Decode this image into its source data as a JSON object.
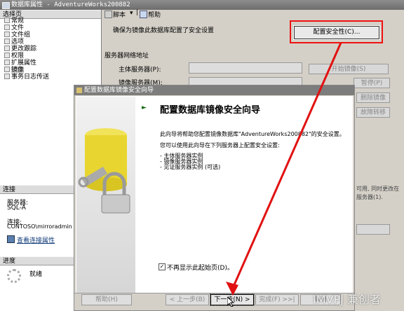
{
  "window": {
    "title": "数据库属性 - AdventureWorks200882"
  },
  "left_pane": {
    "select_page_header": "选择页",
    "pages": [
      "常规",
      "文件",
      "文件组",
      "选项",
      "更改跟踪",
      "权限",
      "扩展属性",
      "镜像",
      "事务日志传送"
    ],
    "connection_header": "连接",
    "server_label": "服务器:",
    "server_value": "SQL-A",
    "connection_label": "连接:",
    "connection_value": "CONTOSO\\mirroradmin",
    "view_connection_link": "查看连接属性",
    "progress_header": "进度",
    "progress_status": "就绪"
  },
  "toolbar": {
    "script_label": "脚本",
    "help_label": "帮助"
  },
  "mirroring": {
    "instruction": "确保为镜像此数据库配置了安全设置",
    "configure_security_button": "配置安全性(C)...",
    "server_address_header": "服务器网络地址",
    "principal_label": "主体服务器(P):",
    "mirror_label": "镜像服务器(M):",
    "start_mirroring_button": "开始镜像(S)",
    "pause_button": "暂停(P)",
    "remove_button": "删除镜像",
    "failover_button": "故障转移",
    "right_note_1": "可用, 同时更改在",
    "right_note_2": "服务器(1)."
  },
  "wizard": {
    "title": "配置数据库镜像安全向导",
    "heading": "配置数据库镜像安全向导",
    "description": "此向导将帮助您配置镜像数据库\"AdventureWorks200882\"的安全设置。",
    "sub": "您可以使用此向导在下列服务器上配置安全设置:",
    "items": [
      "- 主体服务器实例",
      "- 镜像服务器实例",
      "- 见证服务器实例 (可选)"
    ],
    "checkbox_label": "不再显示此起始页(D)。",
    "checkbox_checked": true,
    "help_button": "帮助(H)",
    "back_button": "< 上一步(B)",
    "next_button": "下一步(N) >",
    "finish_button": "完成(F) >>|",
    "cancel_button": "取消"
  },
  "watermark": "IMVPJ 兼创者",
  "colors": {
    "highlight_box": "#e11111",
    "arrow": "#e11111"
  }
}
